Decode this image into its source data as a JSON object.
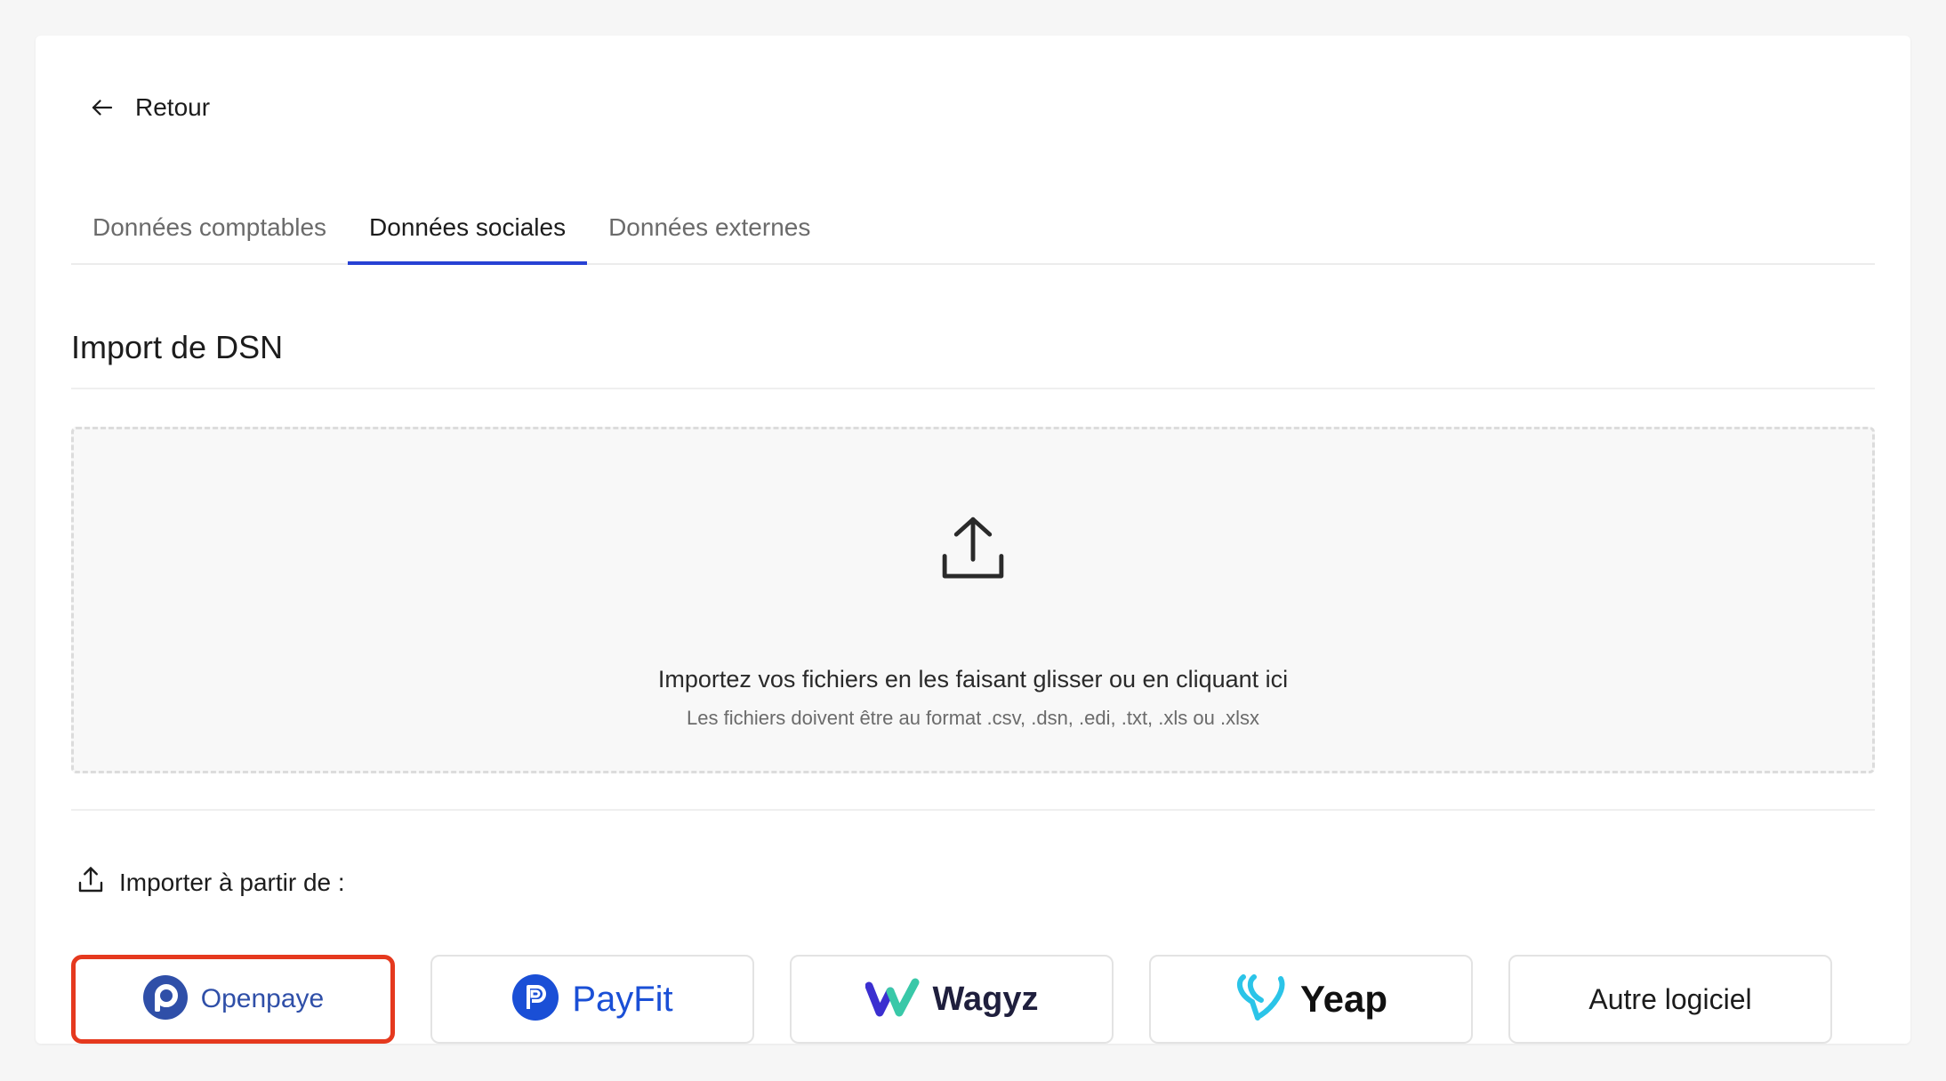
{
  "nav": {
    "back_label": "Retour"
  },
  "tabs": [
    {
      "label": "Données comptables",
      "active": false
    },
    {
      "label": "Données sociales",
      "active": true
    },
    {
      "label": "Données externes",
      "active": false
    }
  ],
  "section": {
    "title": "Import de DSN"
  },
  "dropzone": {
    "title": "Importez vos fichiers en les faisant glisser ou en cliquant ici",
    "subtitle": "Les fichiers doivent être au format .csv, .dsn, .edi, .txt, .xls ou .xlsx"
  },
  "import_from": {
    "label": "Importer à partir de :"
  },
  "providers": [
    {
      "name": "Openpaye",
      "selected": true
    },
    {
      "name": "PayFit",
      "selected": false
    },
    {
      "name": "Wagyz",
      "selected": false
    },
    {
      "name": "Yeap",
      "selected": false
    },
    {
      "name": "Autre logiciel",
      "selected": false
    }
  ],
  "colors": {
    "accent": "#2741d4",
    "selection_outline": "#e5391e",
    "openpaye": "#2f4fa8",
    "payfit": "#1a4fd6",
    "yeap": "#2bc4e8"
  }
}
